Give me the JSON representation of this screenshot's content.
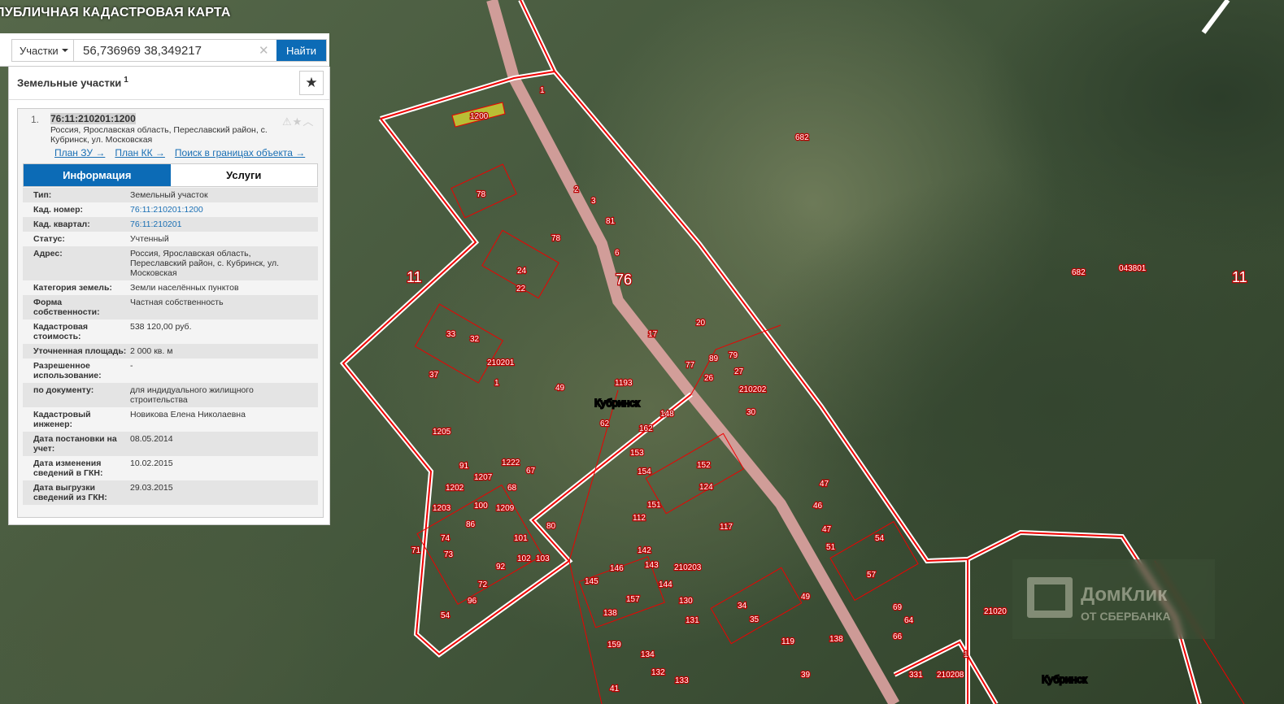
{
  "app": {
    "title": "ПУБЛИЧНАЯ КАДАСТРОВАЯ КАРТА"
  },
  "search": {
    "type_label": "Участки",
    "value": "56,736969 38,349217",
    "clear_icon": "close-icon",
    "find_label": "Найти"
  },
  "panel": {
    "title": "Земельные участки",
    "count": "1",
    "star_icon": "star-icon",
    "result": {
      "index": "1.",
      "cad_number": "76:11:210201:1200",
      "address": "Россия, Ярославская область, Переславский район, с. Кубринск, ул. Московская",
      "links": [
        "План ЗУ →",
        "План КК →",
        "Поиск в границах объекта →"
      ],
      "tabs": [
        "Информация",
        "Услуги"
      ],
      "info": [
        {
          "k": "Тип:",
          "v": "Земельный участок"
        },
        {
          "k": "Кад. номер:",
          "v": "76:11:210201:1200",
          "link": true
        },
        {
          "k": "Кад. квартал:",
          "v": "76:11:210201",
          "link": true
        },
        {
          "k": "Статус:",
          "v": "Учтенный"
        },
        {
          "k": "Адрес:",
          "v": "Россия, Ярославская область, Переславский район, с. Кубринск, ул. Московская"
        },
        {
          "k": "Категория земель:",
          "v": "Земли населённых пунктов"
        },
        {
          "k": "Форма собственности:",
          "v": "Частная собственность"
        },
        {
          "k": "Кадастровая стоимость:",
          "v": "538 120,00 руб."
        },
        {
          "k": "Уточненная площадь:",
          "v": "2 000 кв. м"
        },
        {
          "k": "Разрешенное использование:",
          "v": "-"
        },
        {
          "k": "по документу:",
          "v": "для индидуального жилищного строительства"
        },
        {
          "k": "Кадастровый инженер:",
          "v": "Новикова Елена Николаевна"
        },
        {
          "k": "Дата постановки на учет:",
          "v": "08.05.2014"
        },
        {
          "k": "Дата изменения сведений в ГКН:",
          "v": "10.02.2015"
        },
        {
          "k": "Дата выгрузки сведений из ГКН:",
          "v": "29.03.2015"
        }
      ]
    }
  },
  "map": {
    "big_labels": [
      "11",
      "11",
      "76"
    ],
    "quarter_labels": [
      "682",
      "682",
      "043801",
      "210201",
      "210202",
      "210203",
      "210208",
      "21020"
    ],
    "town_labels": [
      "Кубринск",
      "Кубринск"
    ],
    "plot_labels": [
      "1200",
      "1",
      "78",
      "2",
      "3",
      "81",
      "6",
      "78",
      "24",
      "22",
      "33",
      "32",
      "37",
      "1",
      "49",
      "1193",
      "17",
      "20",
      "77",
      "89",
      "79",
      "26",
      "27",
      "30",
      "62",
      "162",
      "148",
      "153",
      "154",
      "152",
      "124",
      "151",
      "112",
      "117",
      "47",
      "46",
      "47",
      "51",
      "54",
      "57",
      "142",
      "143",
      "146",
      "145",
      "144",
      "130",
      "131",
      "138",
      "157",
      "159",
      "134",
      "132",
      "133",
      "34",
      "35",
      "49",
      "119",
      "138",
      "39",
      "66",
      "64",
      "69",
      "1205",
      "91",
      "1207",
      "1222",
      "67",
      "68",
      "1202",
      "1203",
      "100",
      "1209",
      "71",
      "74",
      "86",
      "73",
      "101",
      "102",
      "80",
      "103",
      "92",
      "72",
      "96",
      "54",
      "331",
      "1",
      "41"
    ],
    "watermark": {
      "line1": "ДомКлик",
      "line2": "ОТ СБЕРБАНКА"
    }
  }
}
